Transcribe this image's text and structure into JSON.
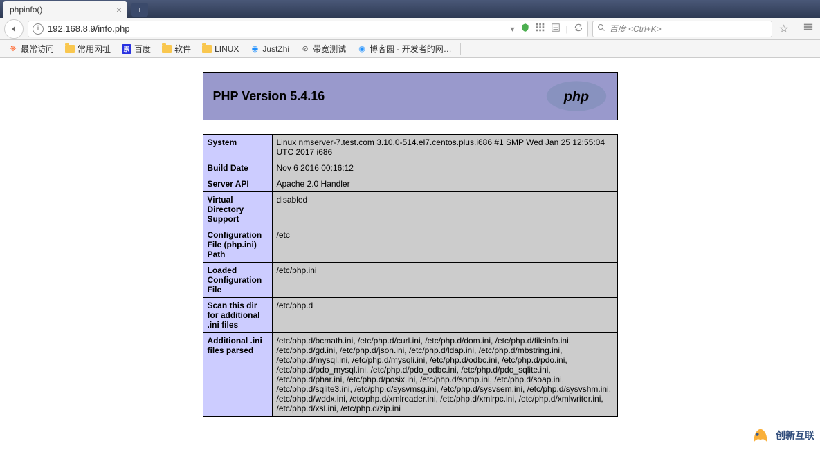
{
  "browser": {
    "tab_title": "phpinfo()",
    "url": "192.168.8.9/info.php",
    "search_placeholder": "百度 <Ctrl+K>"
  },
  "bookmarks": [
    {
      "icon": "snowflake",
      "label": "最常访问"
    },
    {
      "icon": "folder",
      "label": "常用网址"
    },
    {
      "icon": "baidu",
      "label": "百度"
    },
    {
      "icon": "folder",
      "label": "软件"
    },
    {
      "icon": "folder",
      "label": "LINUX"
    },
    {
      "icon": "blue",
      "label": "JustZhi"
    },
    {
      "icon": "clock",
      "label": "带宽测试"
    },
    {
      "icon": "blue",
      "label": "博客园 - 开发者的网…"
    }
  ],
  "php": {
    "header_title": "PHP Version 5.4.16",
    "rows": [
      {
        "key": "System",
        "val": "Linux nmserver-7.test.com 3.10.0-514.el7.centos.plus.i686 #1 SMP Wed Jan 25 12:55:04 UTC 2017 i686"
      },
      {
        "key": "Build Date",
        "val": "Nov 6 2016 00:16:12"
      },
      {
        "key": "Server API",
        "val": "Apache 2.0 Handler"
      },
      {
        "key": "Virtual Directory Support",
        "val": "disabled"
      },
      {
        "key": "Configuration File (php.ini) Path",
        "val": "/etc"
      },
      {
        "key": "Loaded Configuration File",
        "val": "/etc/php.ini"
      },
      {
        "key": "Scan this dir for additional .ini files",
        "val": "/etc/php.d"
      },
      {
        "key": "Additional .ini files parsed",
        "val": "/etc/php.d/bcmath.ini, /etc/php.d/curl.ini, /etc/php.d/dom.ini, /etc/php.d/fileinfo.ini, /etc/php.d/gd.ini, /etc/php.d/json.ini, /etc/php.d/ldap.ini, /etc/php.d/mbstring.ini, /etc/php.d/mysql.ini, /etc/php.d/mysqli.ini, /etc/php.d/odbc.ini, /etc/php.d/pdo.ini, /etc/php.d/pdo_mysql.ini, /etc/php.d/pdo_odbc.ini, /etc/php.d/pdo_sqlite.ini, /etc/php.d/phar.ini, /etc/php.d/posix.ini, /etc/php.d/snmp.ini, /etc/php.d/soap.ini, /etc/php.d/sqlite3.ini, /etc/php.d/sysvmsg.ini, /etc/php.d/sysvsem.ini, /etc/php.d/sysvshm.ini, /etc/php.d/wddx.ini, /etc/php.d/xmlreader.ini, /etc/php.d/xmlrpc.ini, /etc/php.d/xmlwriter.ini, /etc/php.d/xsl.ini, /etc/php.d/zip.ini"
      }
    ]
  },
  "watermark": {
    "text": "创新互联"
  }
}
